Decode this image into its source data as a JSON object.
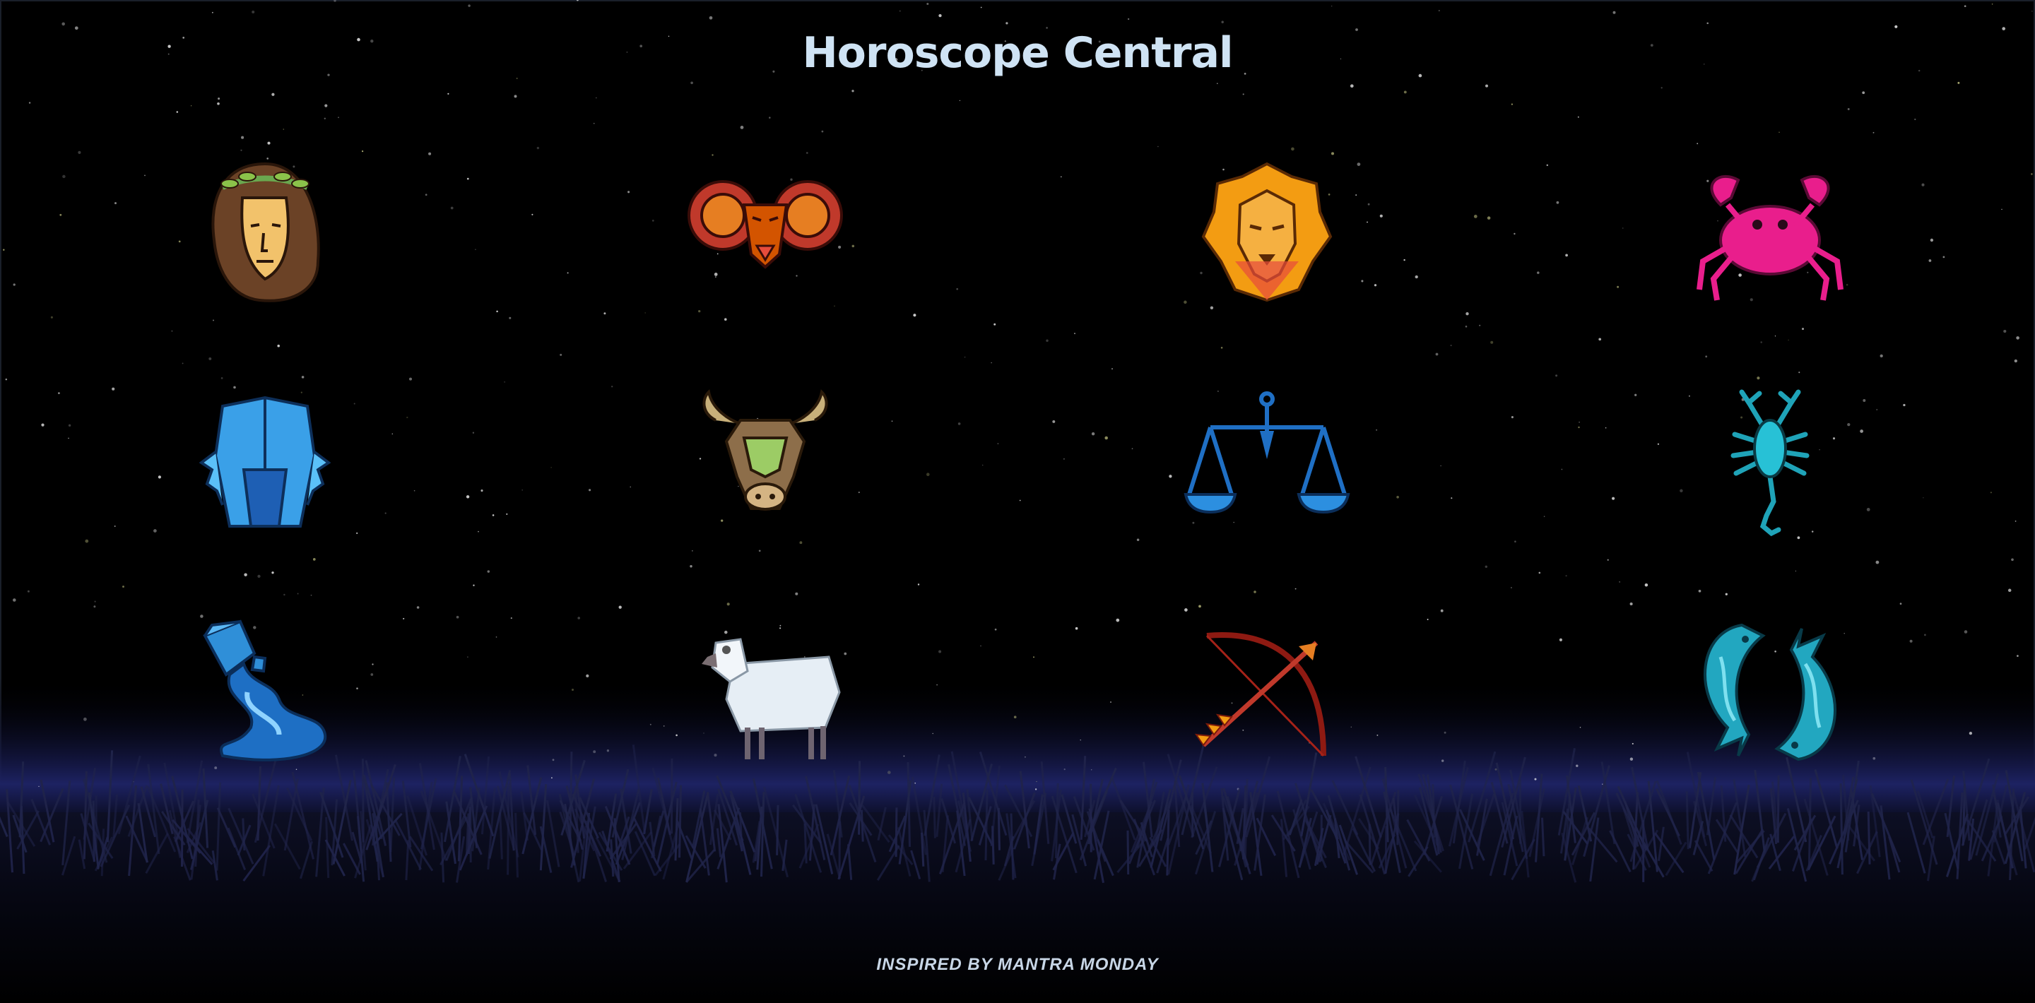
{
  "header": {
    "title": "Horoscope Central"
  },
  "signs": [
    {
      "name": "Virgo",
      "icon": "virgo-maiden-icon"
    },
    {
      "name": "Aries",
      "icon": "aries-ram-icon"
    },
    {
      "name": "Leo",
      "icon": "leo-lion-icon"
    },
    {
      "name": "Cancer",
      "icon": "cancer-crab-icon"
    },
    {
      "name": "Gemini",
      "icon": "gemini-twins-icon"
    },
    {
      "name": "Taurus",
      "icon": "taurus-bull-icon"
    },
    {
      "name": "Libra",
      "icon": "libra-scales-icon"
    },
    {
      "name": "Scorpio",
      "icon": "scorpio-scorpion-icon"
    },
    {
      "name": "Aquarius",
      "icon": "aquarius-water-bearer-icon"
    },
    {
      "name": "Sheep",
      "icon": "sheep-icon"
    },
    {
      "name": "Sagittarius",
      "icon": "sagittarius-bow-arrow-icon"
    },
    {
      "name": "Pisces",
      "icon": "pisces-fish-icon"
    }
  ],
  "footer": {
    "text": "INSPIRED BY MANTRA MONDAY"
  },
  "colors": {
    "background": "#000000",
    "title": "#cfe3f4",
    "footer": "#c8d6e6",
    "horizon_glow": "#1c2060",
    "grass": "#1a1d3a"
  }
}
